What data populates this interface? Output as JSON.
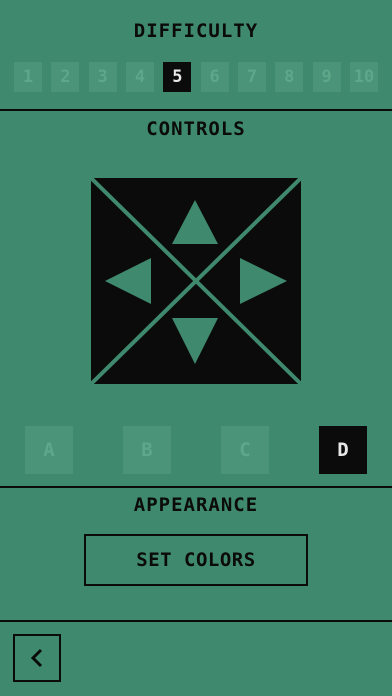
{
  "difficulty": {
    "title": "DIFFICULTY",
    "levels": [
      "1",
      "2",
      "3",
      "4",
      "5",
      "6",
      "7",
      "8",
      "9",
      "10"
    ],
    "selected": "5"
  },
  "controls": {
    "title": "CONTROLS",
    "dpad_icons": [
      "arrow-up-icon",
      "arrow-left-icon",
      "arrow-right-icon",
      "arrow-down-icon"
    ],
    "modes": [
      "A",
      "B",
      "C",
      "D"
    ],
    "selected_mode": "D"
  },
  "appearance": {
    "title": "APPEARANCE",
    "set_colors_label": "SET COLORS"
  },
  "nav": {
    "back_icon": "chevron-left-icon"
  },
  "colors": {
    "background": "#3f8a6e",
    "foreground": "#0b0b0b",
    "inactive": "#4b9479"
  }
}
